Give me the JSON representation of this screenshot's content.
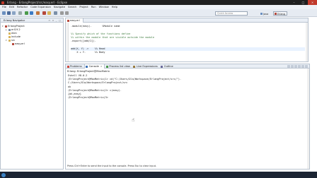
{
  "window": {
    "title": "Erlang - ErlangProject/src/easy.erl - Eclipse"
  },
  "menu": [
    "File",
    "Edit",
    "Refactor",
    "Code Expansion",
    "Navigate",
    "Search",
    "Project",
    "Run",
    "Window",
    "Help"
  ],
  "toolbar": {
    "quick_access_placeholder": "Quick Access",
    "perspectives": [
      "Java",
      "Erlang"
    ]
  },
  "navigator": {
    "title": "Erlang Navigator",
    "tree": [
      {
        "label": "ErlangProject",
        "depth": 0,
        "twisty": "▾",
        "icon": "project-icon",
        "color": "#b5473a"
      },
      {
        "label": "erl19.2",
        "depth": 1,
        "twisty": "▸",
        "icon": "library-icon",
        "color": "#7a8fa8"
      },
      {
        "label": "ebin",
        "depth": 1,
        "twisty": "",
        "icon": "folder-icon",
        "color": "#d8b45a"
      },
      {
        "label": "include",
        "depth": 1,
        "twisty": "",
        "icon": "folder-icon",
        "color": "#d8b45a"
      },
      {
        "label": "src",
        "depth": 1,
        "twisty": "▾",
        "icon": "folder-icon",
        "color": "#d8b45a"
      },
      {
        "label": "easy.erl",
        "depth": 2,
        "twisty": "",
        "icon": "erl-file-icon",
        "color": "#b5473a"
      }
    ]
  },
  "editor": {
    "tab_label": "easy.erl",
    "lines": [
      {
        "type": "code",
        "text": "-module(easy).       %Module name",
        "highlight": false
      },
      {
        "type": "blank",
        "text": "",
        "highlight": false
      },
      {
        "type": "comment",
        "text": "%% Specify which of the functions define",
        "highlight": false
      },
      {
        "type": "comment",
        "text": "%% within the module that are visible outside the module",
        "highlight": false
      },
      {
        "type": "code",
        "text": "-export([add/2]).",
        "highlight": false
      },
      {
        "type": "blank",
        "text": "",
        "highlight": false
      },
      {
        "type": "code",
        "text": "add(X, Y) ->    %% Head",
        "highlight": true
      },
      {
        "type": "code",
        "text": "    X + Y.      %% Body",
        "highlight": false
      }
    ]
  },
  "bottom_panel": {
    "tabs": [
      {
        "label": "Problems",
        "active": false,
        "color": "#d0463a"
      },
      {
        "label": "Console",
        "active": true,
        "color": "#3a6fb5"
      },
      {
        "label": "Process list view",
        "active": false,
        "color": "#4a9a4a"
      },
      {
        "label": "Live Expressions",
        "active": false,
        "color": "#9a7a3a"
      },
      {
        "label": "Outline",
        "active": false,
        "color": "#6a6a9a"
      }
    ],
    "console_title": "Erlang: ErlangProject@MaxMatrix",
    "console_lines": [
      "Eshell V8.0.2",
      "(ErlangProject@MaxMatrix)1> cd(\"C:/Users/Ola/Workspace/ErlangProject/src/\").",
      "C:/Users/Ola/Workspace/ErlangProject/src",
      "ok",
      "(ErlangProject@MaxMatrix)2> c(easy).",
      "{ok,easy}",
      "(ErlangProject@MaxMatrix)3>"
    ],
    "status": "Press Ctrl+Enter to send the input to the console. Press Esc to clear input."
  }
}
